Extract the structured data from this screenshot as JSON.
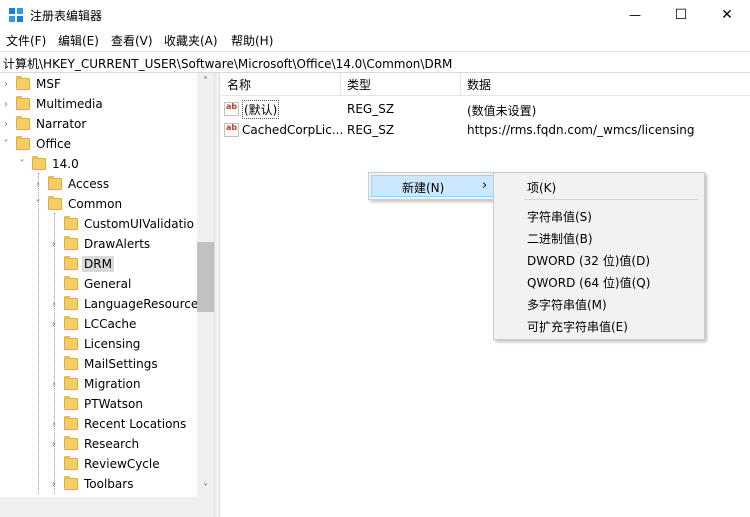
{
  "window": {
    "title": "注册表编辑器",
    "minimize": "—",
    "maximize": "☐",
    "close": "✕"
  },
  "menubar": [
    "文件(F)",
    "编辑(E)",
    "查看(V)",
    "收藏夹(A)",
    "帮助(H)"
  ],
  "address": "计算机\\HKEY_CURRENT_USER\\Software\\Microsoft\\Office\\14.0\\Common\\DRM",
  "tree": {
    "items": [
      {
        "label": "MSF",
        "level": 0,
        "expander": "›"
      },
      {
        "label": "Multimedia",
        "level": 0,
        "expander": "›"
      },
      {
        "label": "Narrator",
        "level": 0,
        "expander": "›"
      },
      {
        "label": "Office",
        "level": 0,
        "expander": "˅"
      },
      {
        "label": "14.0",
        "level": 1,
        "expander": "˅"
      },
      {
        "label": "Access",
        "level": 2,
        "expander": "›"
      },
      {
        "label": "Common",
        "level": 2,
        "expander": "˅"
      },
      {
        "label": "CustomUIValidatio",
        "level": 3,
        "expander": ""
      },
      {
        "label": "DrawAlerts",
        "level": 3,
        "expander": "›"
      },
      {
        "label": "DRM",
        "level": 3,
        "expander": "",
        "selected": true
      },
      {
        "label": "General",
        "level": 3,
        "expander": ""
      },
      {
        "label": "LanguageResources",
        "level": 3,
        "expander": "›"
      },
      {
        "label": "LCCache",
        "level": 3,
        "expander": "›"
      },
      {
        "label": "Licensing",
        "level": 3,
        "expander": ""
      },
      {
        "label": "MailSettings",
        "level": 3,
        "expander": ""
      },
      {
        "label": "Migration",
        "level": 3,
        "expander": "›"
      },
      {
        "label": "PTWatson",
        "level": 3,
        "expander": ""
      },
      {
        "label": "Recent Locations",
        "level": 3,
        "expander": "›"
      },
      {
        "label": "Research",
        "level": 3,
        "expander": "›"
      },
      {
        "label": "ReviewCycle",
        "level": 3,
        "expander": ""
      },
      {
        "label": "Toolbars",
        "level": 3,
        "expander": "›"
      }
    ],
    "scroll_up": "˄",
    "scroll_down": "˅"
  },
  "list": {
    "headers": [
      "名称",
      "类型",
      "数据"
    ],
    "rows": [
      {
        "name": "(默认)",
        "type": "REG_SZ",
        "data": "(数值未设置)"
      },
      {
        "name": "CachedCorpLic...",
        "type": "REG_SZ",
        "data": "https://rms.fqdn.com/_wmcs/licensing"
      }
    ],
    "icon_text": "ab"
  },
  "context_menu": {
    "new_label": "新建(N)",
    "arrow": "›",
    "submenu": [
      "项(K)",
      "字符串值(S)",
      "二进制值(B)",
      "DWORD (32 位)值(D)",
      "QWORD (64 位)值(Q)",
      "多字符串值(M)",
      "可扩充字符串值(E)"
    ]
  }
}
